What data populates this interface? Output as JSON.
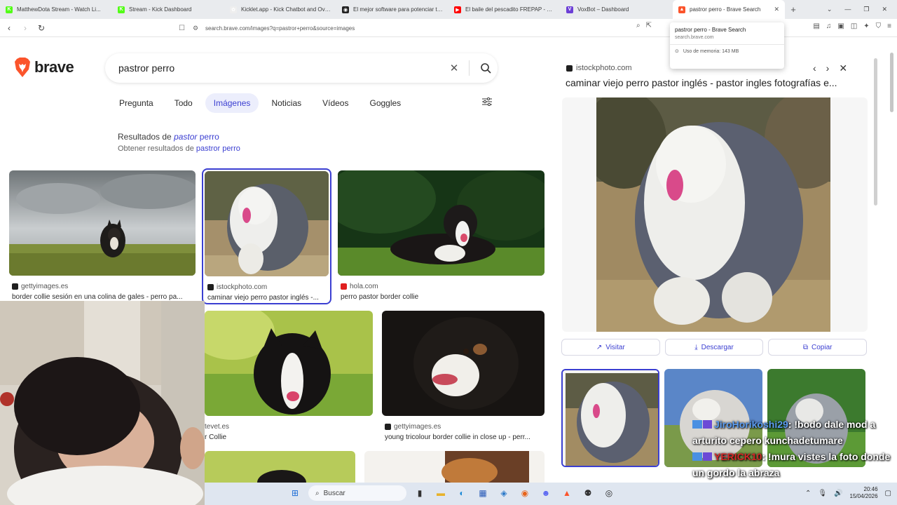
{
  "tabs": [
    {
      "title": "MatthewDota Stream - Watch Li...",
      "color": "#53fc18",
      "glyph": "K"
    },
    {
      "title": "Stream - Kick Dashboard",
      "color": "#53fc18",
      "glyph": "K"
    },
    {
      "title": "Kicklet.app - Kick Chatbot and Ove...",
      "color": "#eeeeee",
      "glyph": "✿"
    },
    {
      "title": "El mejor software para potenciar tu ...",
      "color": "#222222",
      "glyph": "◉"
    },
    {
      "title": "El baile del pescadito FREPAP - YouT...",
      "color": "#ff0000",
      "glyph": "▶"
    },
    {
      "title": "VoxBot – Dashboard",
      "color": "#6c3fd6",
      "glyph": "V"
    },
    {
      "title": "pastror perro - Brave Search",
      "color": "#fb542b",
      "glyph": "▲"
    }
  ],
  "url": "search.brave.com/images?q=pastror+perro&source=images",
  "hover_card": {
    "title": "pastror perro - Brave Search",
    "domain": "search.brave.com",
    "memory": "Uso de memoria: 143 MB"
  },
  "brand": {
    "wordmark": "brave",
    "accent": "#fb542b",
    "link": "#3b3fd1"
  },
  "search": {
    "query": "pastror perro"
  },
  "filters": [
    {
      "label": "Pregunta",
      "active": false
    },
    {
      "label": "Todo",
      "active": false
    },
    {
      "label": "Imágenes",
      "active": true
    },
    {
      "label": "Noticias",
      "active": false
    },
    {
      "label": "Vídeos",
      "active": false
    },
    {
      "label": "Goggles",
      "active": false
    }
  ],
  "correction": {
    "prefix": "Resultados de ",
    "q1": "pastor",
    "q2": " perro",
    "alt_prefix": "Obtener resultados de ",
    "alt_query": "pastror perro"
  },
  "results": [
    {
      "source": "gettyimages.es",
      "caption": "border collie sesión en una colina de gales - perro pa...",
      "src_color": "#1f1f1f"
    },
    {
      "source": "istockphoto.com",
      "caption": "caminar viejo perro pastor inglés -...",
      "src_color": "#1f1f1f"
    },
    {
      "source": "hola.com",
      "caption": "perro pastor border collie",
      "src_color": "#e02020"
    },
    {
      "source": "tevet.es",
      "caption": "r Collie",
      "src_color": "#888888"
    },
    {
      "source": "gettyimages.es",
      "caption": "young tricolour border collie in close up - perr...",
      "src_color": "#1f1f1f"
    }
  ],
  "panel": {
    "source": "istockphoto.com",
    "title": "caminar viejo perro pastor inglés - pastor ingles fotografías e...",
    "buttons": {
      "visit": "Visitar",
      "download": "Descargar",
      "copy": "Copiar"
    }
  },
  "chat": [
    {
      "user": "JiroHorikoshi29",
      "msg": ": !bodo dale mod a arturito cepero kunchadetumare"
    },
    {
      "user": "YERICK10",
      "msg": ": !mura vistes la foto donde un gordo la abraza"
    }
  ],
  "taskbar": {
    "search_label": "Buscar",
    "time": "20:46",
    "date": "15/04/2026"
  }
}
